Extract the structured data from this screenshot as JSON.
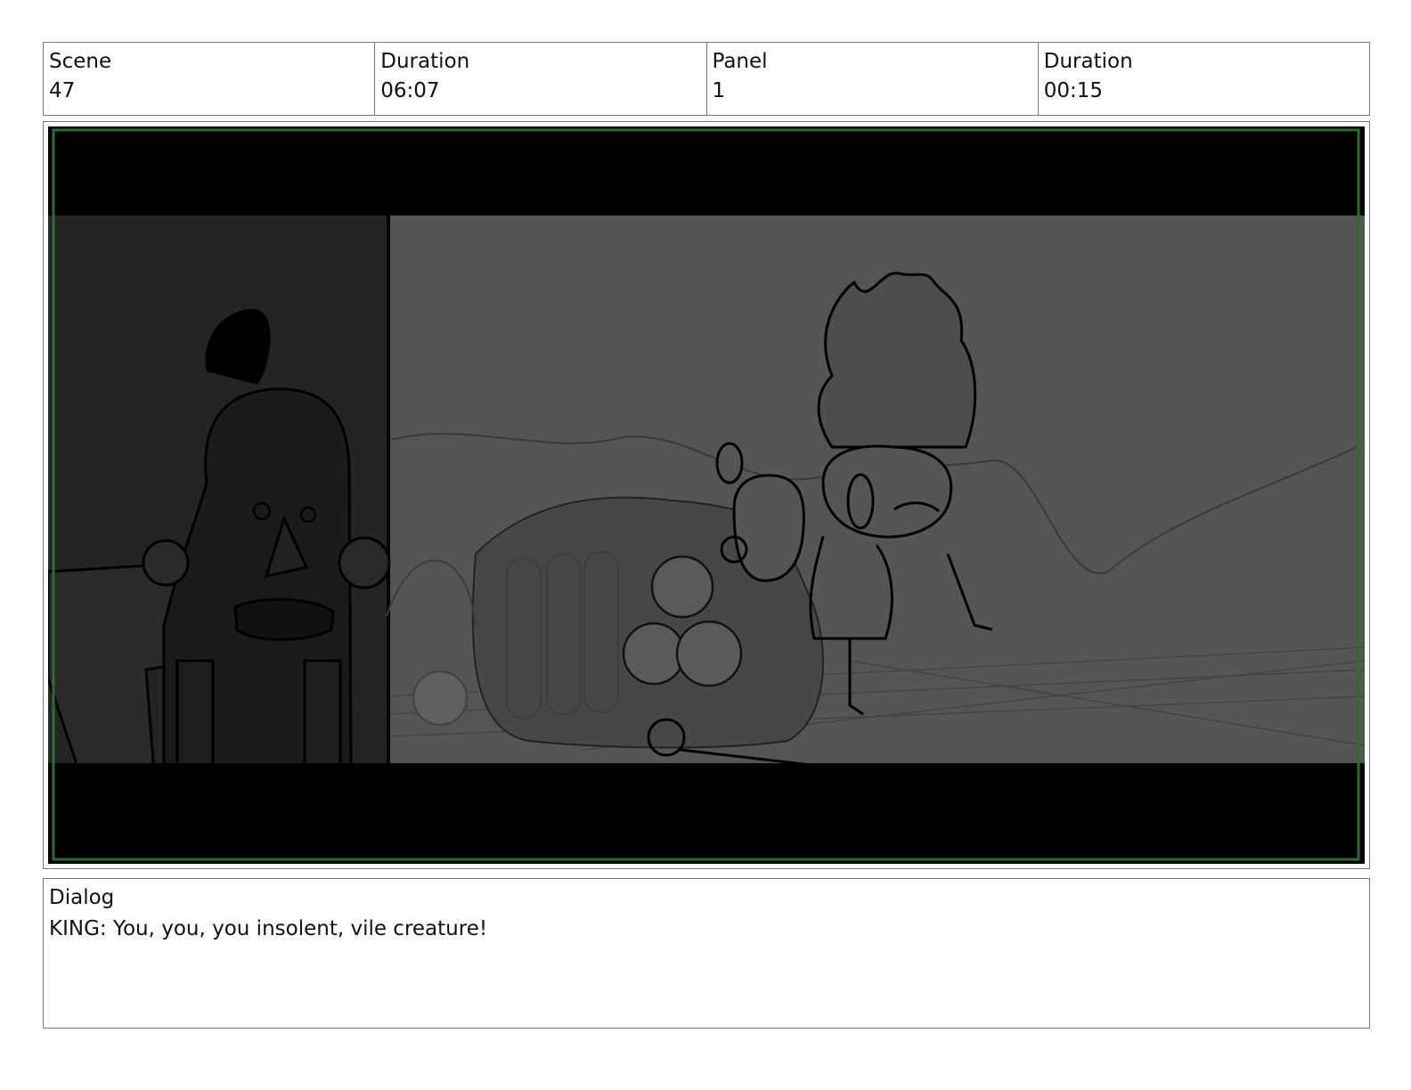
{
  "header": {
    "scene_label": "Scene",
    "scene_value": "47",
    "scene_duration_label": "Duration",
    "scene_duration_value": "06:07",
    "panel_label": "Panel",
    "panel_value": "1",
    "panel_duration_label": "Duration",
    "panel_duration_value": "00:15"
  },
  "dialog": {
    "label": "Dialog",
    "text": "KING: You, you, you insolent, vile creature!"
  },
  "colors": {
    "frame_border": "#2f6b2f",
    "letterbox": "#000000",
    "background_gray": "#555555",
    "wall_dark": "#242424"
  }
}
